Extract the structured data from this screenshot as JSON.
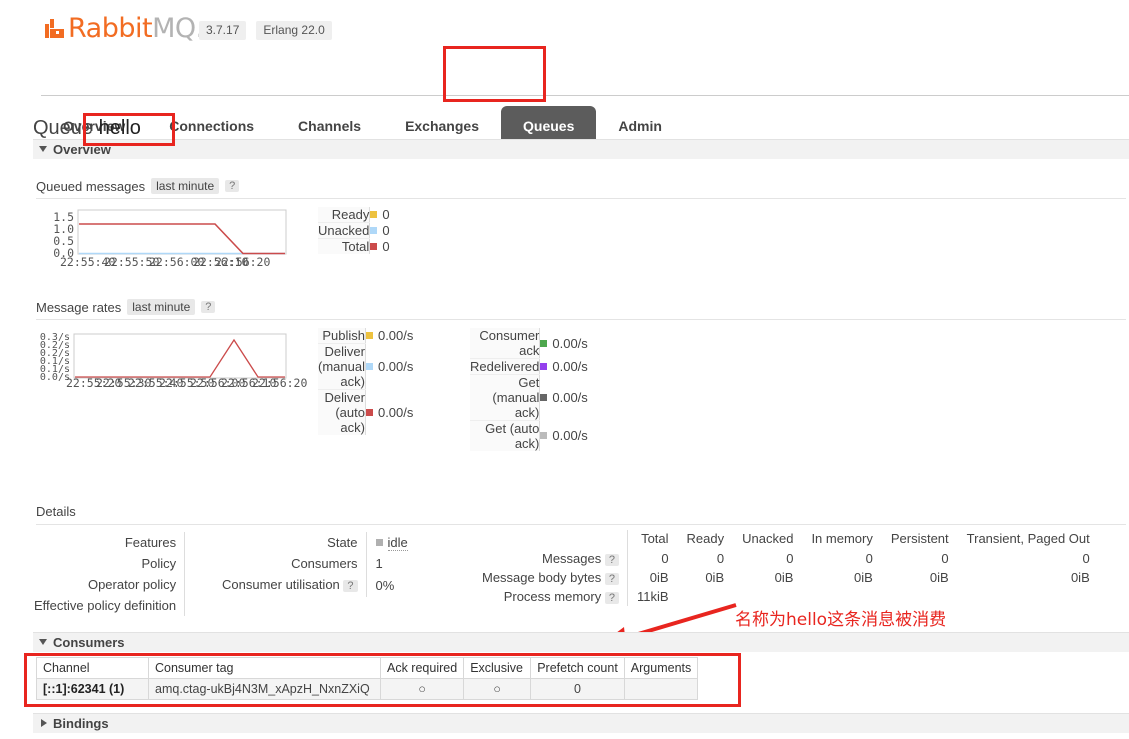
{
  "header": {
    "logo_rabbit": "Rabbit",
    "logo_mq": "MQ.",
    "version_badge": "3.7.17",
    "erlang_badge": "Erlang 22.0"
  },
  "nav": {
    "items": [
      {
        "label": "Overview",
        "active": false
      },
      {
        "label": "Connections",
        "active": false
      },
      {
        "label": "Channels",
        "active": false
      },
      {
        "label": "Exchanges",
        "active": false
      },
      {
        "label": "Queues",
        "active": true
      },
      {
        "label": "Admin",
        "active": false
      }
    ]
  },
  "page": {
    "title_prefix": "Queue",
    "queue_name": "hello"
  },
  "sections": {
    "overview": "Overview",
    "details": "Details",
    "consumers": "Consumers",
    "bindings": "Bindings"
  },
  "queued_messages": {
    "heading": "Queued messages",
    "period": "last minute",
    "help": "?",
    "legend": [
      {
        "label": "Ready",
        "value": "0",
        "color": "#edc240"
      },
      {
        "label": "Unacked",
        "value": "0",
        "color": "#afd8f8"
      },
      {
        "label": "Total",
        "value": "0",
        "color": "#cb4b4b"
      }
    ]
  },
  "message_rates": {
    "heading": "Message rates",
    "period": "last minute",
    "help": "?",
    "legend_left": [
      {
        "label": "Publish",
        "value": "0.00/s",
        "color": "#edc240"
      },
      {
        "label": "Deliver\n(manual\nack)",
        "value": "0.00/s",
        "color": "#afd8f8"
      },
      {
        "label": "Deliver\n(auto\nack)",
        "value": "0.00/s",
        "color": "#cb4b4b"
      }
    ],
    "legend_right": [
      {
        "label": "Consumer\nack",
        "value": "0.00/s",
        "color": "#4da74d"
      },
      {
        "label": "Redelivered",
        "value": "0.00/s",
        "color": "#9440ed"
      },
      {
        "label": "Get\n(manual\nack)",
        "value": "0.00/s",
        "color": "#666666"
      },
      {
        "label": "Get (auto\nack)",
        "value": "0.00/s",
        "color": "#bbbbbb"
      }
    ]
  },
  "chart_data": [
    {
      "type": "line",
      "title": "Queued messages",
      "xlabel": "",
      "ylabel": "",
      "ylim": [
        0,
        1.5
      ],
      "yticks": [
        "1.5",
        "1.0",
        "0.5",
        "0.0"
      ],
      "xticks": [
        "22:55:40",
        "22:55:50",
        "22:56:00",
        "22:56:10",
        "22:56:20"
      ],
      "grid": false,
      "legend_position": "right",
      "series": [
        {
          "name": "Total",
          "color": "#cb4b4b",
          "x": [
            0,
            0.66,
            0.8,
            1.0
          ],
          "values": [
            1,
            1,
            0,
            0
          ]
        },
        {
          "name": "Ready",
          "color": "#edc240",
          "x": [
            0,
            1.0
          ],
          "values": [
            0,
            0
          ]
        },
        {
          "name": "Unacked",
          "color": "#afd8f8",
          "x": [
            0,
            1.0
          ],
          "values": [
            0,
            0
          ]
        }
      ]
    },
    {
      "type": "line",
      "title": "Message rates",
      "xlabel": "",
      "ylabel": "",
      "ylim": [
        0,
        0.3
      ],
      "yticks": [
        "0.3/s",
        "0.2/s",
        "0.2/s",
        "0.1/s",
        "0.1/s",
        "0.0/s"
      ],
      "xticks": [
        "22:55:20",
        "22:55:30",
        "22:55:40",
        "22:55:50",
        "22:56:00",
        "22:56:10",
        "22:56:20"
      ],
      "grid": false,
      "legend_position": "right",
      "series": [
        {
          "name": "Deliver (auto ack)",
          "color": "#cb4b4b",
          "x": [
            0,
            0.64,
            0.78,
            0.92,
            1.0
          ],
          "values": [
            0,
            0,
            0.27,
            0,
            0
          ]
        }
      ]
    }
  ],
  "details": {
    "left_keys": [
      "Features",
      "Policy",
      "Operator policy",
      "Effective policy definition"
    ],
    "mid_rows": [
      {
        "key": "State",
        "value": "idle",
        "help": false,
        "marker": "#b0b0b0"
      },
      {
        "key": "Consumers",
        "value": "1",
        "help": false
      },
      {
        "key": "Consumer utilisation",
        "value": "0%",
        "help": true
      }
    ],
    "stats": {
      "columns": [
        "Total",
        "Ready",
        "Unacked",
        "In memory",
        "Persistent",
        "Transient, Paged Out"
      ],
      "rows": [
        {
          "key": "Messages",
          "help": "?",
          "values": [
            "0",
            "0",
            "0",
            "0",
            "0",
            "0"
          ]
        },
        {
          "key": "Message body bytes",
          "help": "?",
          "values": [
            "0iB",
            "0iB",
            "0iB",
            "0iB",
            "0iB",
            "0iB"
          ]
        },
        {
          "key": "Process memory",
          "help": "?",
          "values": [
            "11kiB",
            "",
            "",
            "",
            "",
            ""
          ]
        }
      ]
    }
  },
  "consumers_table": {
    "columns": [
      "Channel",
      "Consumer tag",
      "Ack required",
      "Exclusive",
      "Prefetch count",
      "Arguments"
    ],
    "rows": [
      {
        "channel": "[::1]:62341 (1)",
        "consumer_tag": "amq.ctag-ukBj4N3M_xApzH_NxnZXiQ",
        "ack_required": "○",
        "exclusive": "○",
        "prefetch_count": "0",
        "arguments": ""
      }
    ]
  },
  "annotation": {
    "text": "名称为hello这条消息被消费",
    "color": "#e8251f"
  }
}
